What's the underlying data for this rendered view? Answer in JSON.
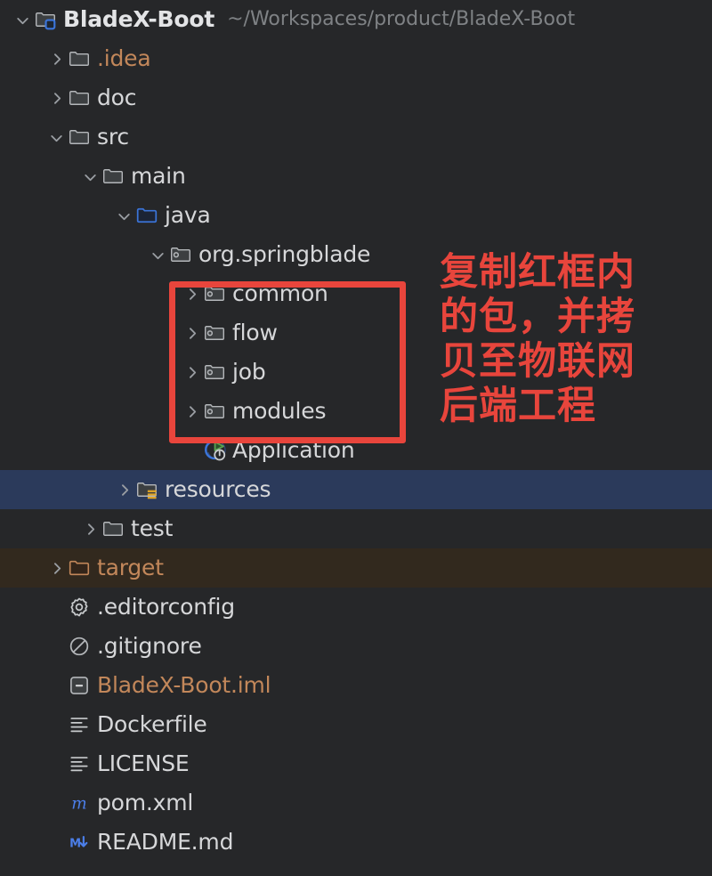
{
  "project": {
    "root_label": "BladeX-Boot",
    "root_path": "~/Workspaces/product/BladeX-Boot"
  },
  "colors": {
    "background": "#262729",
    "selected_row": "#2b3a5b",
    "excluded_row": "#32291e",
    "annotation_red": "#e8453c",
    "text_default": "#d6d7d9",
    "text_path": "#7f8285",
    "text_orange": "#c2875a",
    "source_root_blue": "#3b6eb8",
    "resources_badge": "#e0a526"
  },
  "annotation": {
    "text": "复制红框内的包，并拷贝至物联网后端工程",
    "highlight_targets": [
      "common",
      "flow",
      "job",
      "modules"
    ]
  },
  "tree": [
    {
      "label": "BladeX-Boot",
      "path": "~/Workspaces/product/BladeX-Boot",
      "depth": 0,
      "arrow": "expanded",
      "icon": "module-folder-icon",
      "style": "bold",
      "state": "normal"
    },
    {
      "label": ".idea",
      "depth": 1,
      "arrow": "collapsed",
      "icon": "folder-icon",
      "style": "orange",
      "state": "normal"
    },
    {
      "label": "doc",
      "depth": 1,
      "arrow": "collapsed",
      "icon": "folder-icon",
      "style": "normal",
      "state": "normal"
    },
    {
      "label": "src",
      "depth": 1,
      "arrow": "expanded",
      "icon": "folder-icon",
      "style": "normal",
      "state": "normal"
    },
    {
      "label": "main",
      "depth": 2,
      "arrow": "expanded",
      "icon": "folder-icon",
      "style": "normal",
      "state": "normal"
    },
    {
      "label": "java",
      "depth": 3,
      "arrow": "expanded",
      "icon": "source-root-folder-icon",
      "style": "normal",
      "state": "normal"
    },
    {
      "label": "org.springblade",
      "depth": 4,
      "arrow": "expanded",
      "icon": "package-icon",
      "style": "normal",
      "state": "normal"
    },
    {
      "label": "common",
      "depth": 5,
      "arrow": "collapsed",
      "icon": "package-icon",
      "style": "normal",
      "state": "normal"
    },
    {
      "label": "flow",
      "depth": 5,
      "arrow": "collapsed",
      "icon": "package-icon",
      "style": "normal",
      "state": "normal"
    },
    {
      "label": "job",
      "depth": 5,
      "arrow": "collapsed",
      "icon": "package-icon",
      "style": "normal",
      "state": "normal"
    },
    {
      "label": "modules",
      "depth": 5,
      "arrow": "collapsed",
      "icon": "package-icon",
      "style": "normal",
      "state": "normal"
    },
    {
      "label": "Application",
      "depth": 5,
      "arrow": "none",
      "icon": "spring-boot-run-icon",
      "style": "normal",
      "state": "normal"
    },
    {
      "label": "resources",
      "depth": 3,
      "arrow": "collapsed",
      "icon": "resources-folder-icon",
      "style": "normal",
      "state": "selected"
    },
    {
      "label": "test",
      "depth": 2,
      "arrow": "collapsed",
      "icon": "folder-icon",
      "style": "normal",
      "state": "normal"
    },
    {
      "label": "target",
      "depth": 1,
      "arrow": "collapsed",
      "icon": "excluded-folder-icon",
      "style": "orange",
      "state": "excluded"
    },
    {
      "label": ".editorconfig",
      "depth": 1,
      "arrow": "none",
      "icon": "gear-icon",
      "style": "normal",
      "state": "normal"
    },
    {
      "label": ".gitignore",
      "depth": 1,
      "arrow": "none",
      "icon": "ignore-circle-icon",
      "style": "normal",
      "state": "normal"
    },
    {
      "label": "BladeX-Boot.iml",
      "depth": 1,
      "arrow": "none",
      "icon": "iml-module-icon",
      "style": "orange",
      "state": "normal"
    },
    {
      "label": "Dockerfile",
      "depth": 1,
      "arrow": "none",
      "icon": "text-file-icon",
      "style": "normal",
      "state": "normal"
    },
    {
      "label": "LICENSE",
      "depth": 1,
      "arrow": "none",
      "icon": "text-file-icon",
      "style": "normal",
      "state": "normal"
    },
    {
      "label": "pom.xml",
      "depth": 1,
      "arrow": "none",
      "icon": "maven-pom-icon",
      "style": "normal",
      "state": "normal"
    },
    {
      "label": "README.md",
      "depth": 1,
      "arrow": "none",
      "icon": "markdown-icon",
      "style": "normal",
      "state": "normal"
    }
  ]
}
